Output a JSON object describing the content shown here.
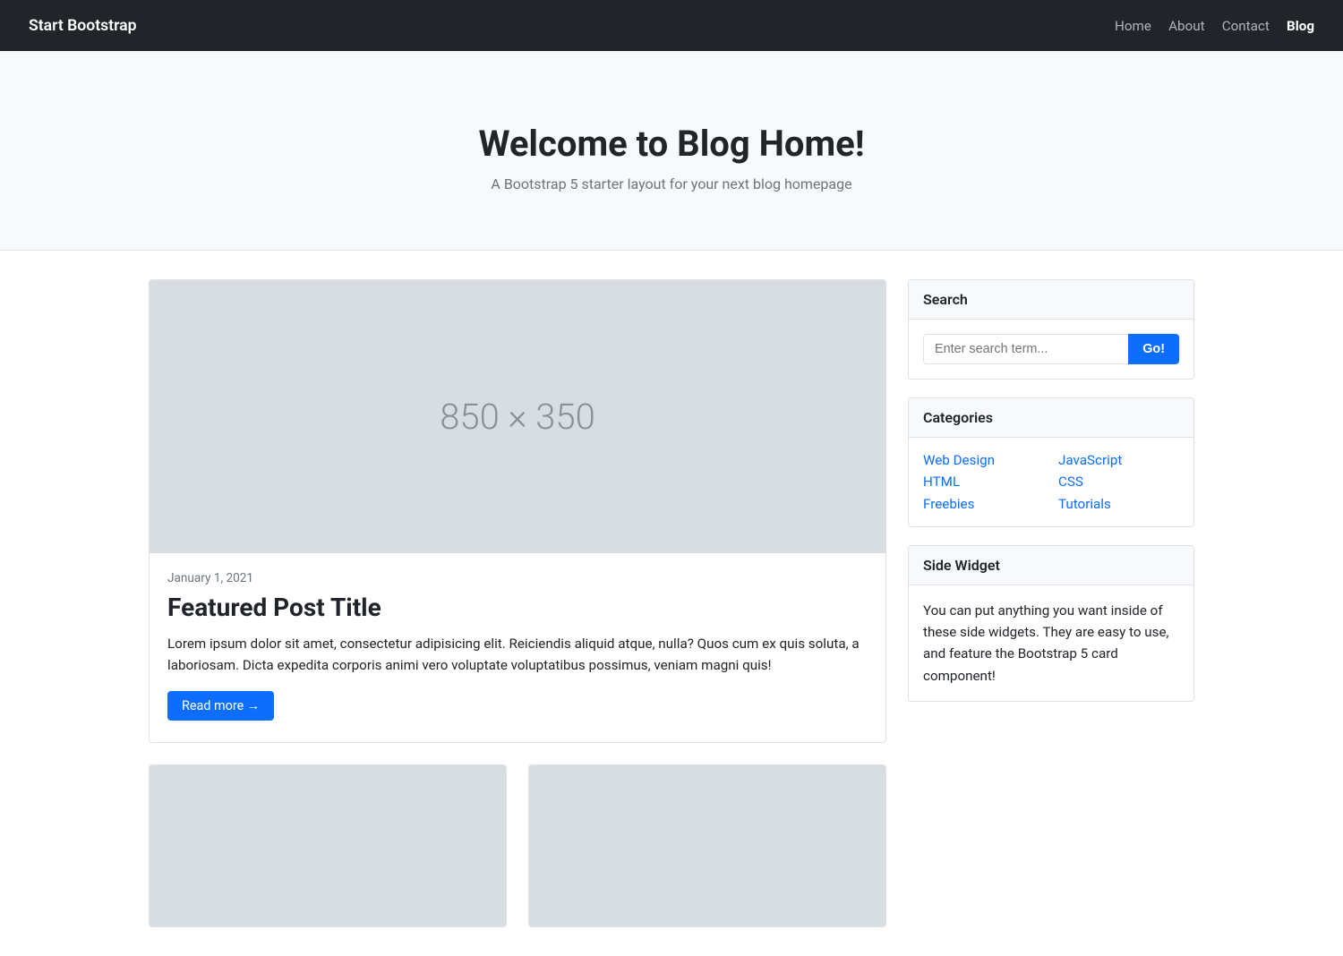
{
  "navbar": {
    "brand": "Start Bootstrap",
    "links": [
      {
        "label": "Home",
        "active": false
      },
      {
        "label": "About",
        "active": false
      },
      {
        "label": "Contact",
        "active": false
      },
      {
        "label": "Blog",
        "active": true
      }
    ]
  },
  "hero": {
    "title": "Welcome to Blog Home!",
    "subtitle": "A Bootstrap 5 starter layout for your next blog homepage"
  },
  "featured_post": {
    "image_label": "850 × 350",
    "date": "January 1, 2021",
    "title": "Featured Post Title",
    "excerpt": "Lorem ipsum dolor sit amet, consectetur adipisicing elit. Reiciendis aliquid atque, nulla? Quos cum ex quis soluta, a laboriosam. Dicta expedita corporis animi vero voluptate voluptatibus possimus, veniam magni quis!",
    "read_more": "Read more →"
  },
  "small_cards": [
    {
      "image_label": ""
    },
    {
      "image_label": ""
    }
  ],
  "sidebar": {
    "search": {
      "header": "Search",
      "placeholder": "Enter search term...",
      "button": "Go!"
    },
    "categories": {
      "header": "Categories",
      "items": [
        {
          "label": "Web Design"
        },
        {
          "label": "JavaScript"
        },
        {
          "label": "HTML"
        },
        {
          "label": "CSS"
        },
        {
          "label": "Freebies"
        },
        {
          "label": "Tutorials"
        }
      ]
    },
    "side_widget": {
      "header": "Side Widget",
      "text": "You can put anything you want inside of these side widgets. They are easy to use, and feature the Bootstrap 5 card component!"
    }
  }
}
